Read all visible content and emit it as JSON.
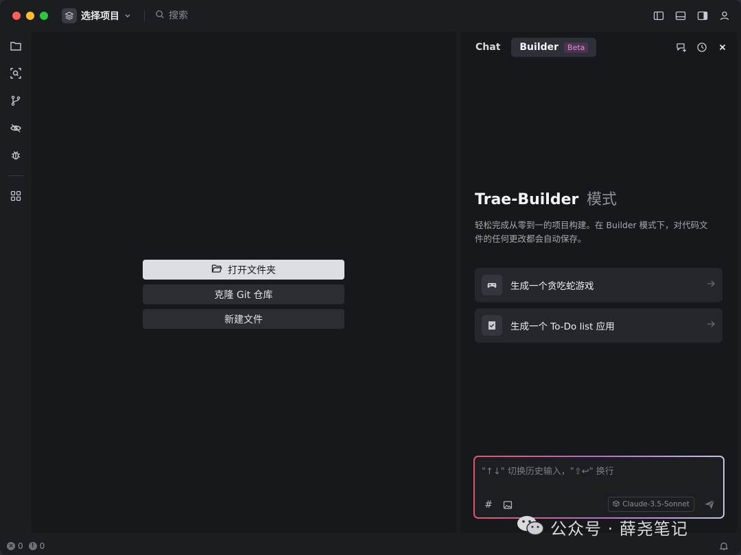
{
  "titlebar": {
    "project_label": "选择项目",
    "search_placeholder": "搜索"
  },
  "activity_bar": {
    "items": [
      "explorer",
      "search",
      "source-control",
      "extensions",
      "debug",
      "apps"
    ]
  },
  "editor": {
    "actions": {
      "open_folder": "打开文件夹",
      "clone_git": "克隆 Git 仓库",
      "new_file": "新建文件"
    }
  },
  "panel": {
    "tabs": {
      "chat": "Chat",
      "builder": "Builder",
      "builder_badge": "Beta"
    },
    "title": "Trae-Builder",
    "title_mode": "模式",
    "description": "轻松完成从零到一的项目构建。在 Builder 模式下，对代码文件的任何更改都会自动保存。",
    "suggestions": [
      {
        "label": "生成一个贪吃蛇游戏",
        "icon": "gamepad-icon"
      },
      {
        "label": "生成一个 To-Do list 应用",
        "icon": "checklist-icon"
      }
    ],
    "input": {
      "placeholder": "\"↑↓\" 切换历史输入，\"⇧↩\" 换行",
      "hash": "#",
      "model": "Claude-3.5-Sonnet"
    }
  },
  "statusbar": {
    "errors": "0",
    "warnings": "0"
  },
  "watermark": {
    "text": "公众号 · 薛尧笔记"
  },
  "colors": {
    "background": "#1c1d21",
    "panel": "#17181b",
    "primary_button": "#dcdee3",
    "badge_text": "#e58ed5",
    "input_border_start": "#e2566a",
    "input_border_end": "#c9c1e8"
  }
}
